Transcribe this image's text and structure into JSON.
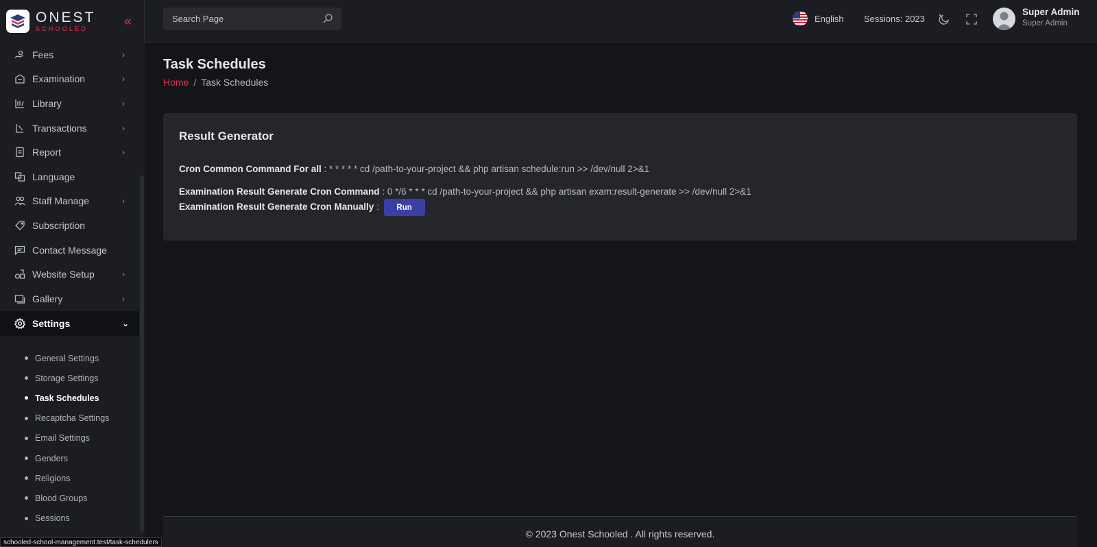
{
  "brand": {
    "name": "ONEST",
    "tagline": "SCHOOLED"
  },
  "sidebar": {
    "items": [
      {
        "label": "Fees",
        "icon": "fees-icon",
        "has_children": true
      },
      {
        "label": "Examination",
        "icon": "examination-icon",
        "has_children": true
      },
      {
        "label": "Library",
        "icon": "library-icon",
        "has_children": true
      },
      {
        "label": "Transactions",
        "icon": "transactions-icon",
        "has_children": true
      },
      {
        "label": "Report",
        "icon": "report-icon",
        "has_children": true
      },
      {
        "label": "Language",
        "icon": "language-icon",
        "has_children": false
      },
      {
        "label": "Staff Manage",
        "icon": "staff-icon",
        "has_children": true
      },
      {
        "label": "Subscription",
        "icon": "tag-icon",
        "has_children": false
      },
      {
        "label": "Contact Message",
        "icon": "message-icon",
        "has_children": false
      },
      {
        "label": "Website Setup",
        "icon": "website-icon",
        "has_children": true
      },
      {
        "label": "Gallery",
        "icon": "gallery-icon",
        "has_children": true
      },
      {
        "label": "Settings",
        "icon": "gear-icon",
        "has_children": true,
        "active": true
      }
    ],
    "settings_submenu": [
      {
        "label": "General Settings"
      },
      {
        "label": "Storage Settings"
      },
      {
        "label": "Task Schedules",
        "active": true
      },
      {
        "label": "Recaptcha Settings"
      },
      {
        "label": "Email Settings"
      },
      {
        "label": "Genders"
      },
      {
        "label": "Religions"
      },
      {
        "label": "Blood Groups"
      },
      {
        "label": "Sessions"
      }
    ]
  },
  "topbar": {
    "search_placeholder": "Search Page",
    "language": "English",
    "sessions": "Sessions: 2023",
    "user_name": "Super Admin",
    "user_role": "Super Admin"
  },
  "page": {
    "title": "Task Schedules",
    "breadcrumb_home": "Home",
    "breadcrumb_sep": "/",
    "breadcrumb_current": "Task Schedules"
  },
  "card": {
    "title": "Result Generator",
    "cron_common_label": "Cron Common Command For all",
    "cron_common_value": " : * * * * * cd /path-to-your-project && php artisan schedule:run >> /dev/null 2>&1",
    "exam_cron_label": "Examination Result Generate Cron Command",
    "exam_cron_value": " : 0 */6 * * * cd /path-to-your-project && php artisan exam:result-generate >> /dev/null 2>&1",
    "exam_manual_label": "Examination Result Generate Cron Manually",
    "exam_manual_sep": " :",
    "run_label": "Run"
  },
  "footer": {
    "text": "© 2023 Onest Schooled . All rights reserved."
  },
  "status_url": "schooled-school-management.test/task-schedulers",
  "colors": {
    "accent": "#e8334a",
    "button": "#3a3fa8",
    "background": "#141519",
    "panel": "#25262c"
  }
}
